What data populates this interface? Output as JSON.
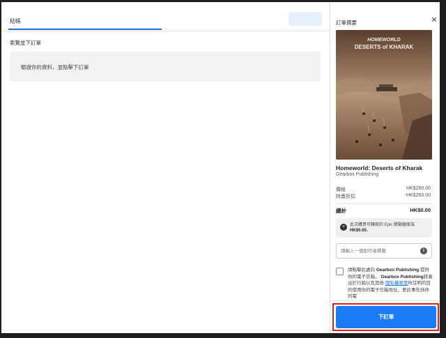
{
  "main": {
    "tab_label": "結帳",
    "review_title": "索覽並下訂單",
    "info_text": "驗證你的資料，並點擊下訂單"
  },
  "summary": {
    "title": "訂單摘要",
    "close_symbol": "✕",
    "cover": {
      "line1": "HOMEWORLD",
      "line2": "DESERTS of KHARAK"
    },
    "game_title": "Homeworld: Deserts of Kharak",
    "publisher": "Gearbox Publishing",
    "price_label": "價格",
    "price_value": "HK$260.00",
    "discount_label": "特賣折扣",
    "discount_value": "-HK$260.00",
    "total_label": "總計",
    "total_value": "HK$0.00",
    "reward_text": "此次購買可賺取的 Epic 獎勵額度為",
    "reward_amount": "HK$0.00",
    "reward_suffix": "。",
    "creator_code_placeholder": "請輸入一個創作者標籤",
    "info_symbol": "i",
    "consent_prefix": "請點擊此處向",
    "consent_company1": "Gearbox Publishing",
    "consent_mid1": "提供你的電子信箱，",
    "consent_company2": "Gearbox Publishing",
    "consent_mid2": "將會出於行銷以及其他",
    "consent_link": "隱私權政策",
    "consent_suffix": "所註明的目的使用你的電子信箱地址，更此事先持你的電",
    "order_button": "下訂單"
  },
  "colors": {
    "accent": "#1a7cf5",
    "tab_underline": "#1a6ed8",
    "highlight_outline": "#e0201b",
    "link": "#1a6ed8"
  }
}
